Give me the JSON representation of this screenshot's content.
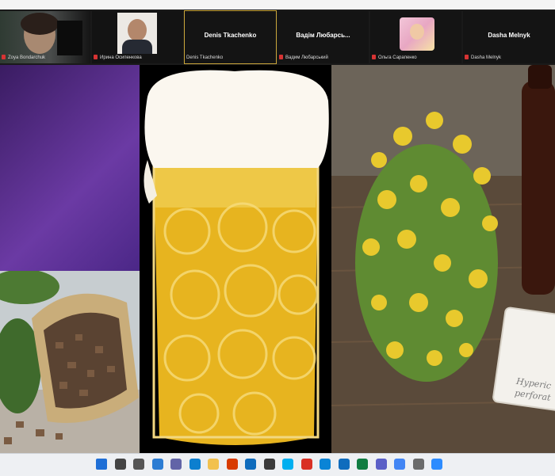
{
  "participants": [
    {
      "label": "Zoya Bondarchuk",
      "tile_name": "",
      "has_video": true,
      "active": false
    },
    {
      "label": "Ирина Осипенкова",
      "tile_name": "",
      "has_video": true,
      "active": false
    },
    {
      "label": "Denis Tkachenko",
      "tile_name": "Denis Tkachenko",
      "has_video": false,
      "active": true
    },
    {
      "label": "Вадим Любарський",
      "tile_name": "Вадім Любарсь...",
      "has_video": false,
      "active": false
    },
    {
      "label": "Ольга Сарапенко",
      "tile_name": "",
      "has_video": true,
      "active": false
    },
    {
      "label": "Dasha Melnyk",
      "tile_name": "Dasha Melnyk",
      "has_video": false,
      "active": false
    }
  ],
  "shared_content": {
    "herb_tag_text": "Hyperic perforat"
  },
  "taskbar": {
    "icons": [
      "windows-start-icon",
      "search-icon",
      "task-view-icon",
      "widgets-icon",
      "chat-icon",
      "edge-icon",
      "file-explorer-icon",
      "office-icon",
      "mail-icon",
      "store-icon",
      "skype-icon",
      "acrobat-icon",
      "photos-icon",
      "outlook-icon",
      "excel-icon",
      "teams-icon",
      "chrome-icon",
      "settings-icon",
      "zoom-icon"
    ],
    "icon_colors": [
      "#1f6fd6",
      "#444444",
      "#555555",
      "#2b7cd3",
      "#6264a7",
      "#0c7fcf",
      "#f2c14e",
      "#d83b01",
      "#0f6cbd",
      "#3a3a3a",
      "#00aff0",
      "#d93025",
      "#0a84d6",
      "#0f6cbd",
      "#107c41",
      "#5b5fc7",
      "#4285f4",
      "#6b6b6b",
      "#2d8cff"
    ]
  },
  "colors": {
    "mic_muted": "#d63333",
    "active_border": "#caa63a"
  }
}
